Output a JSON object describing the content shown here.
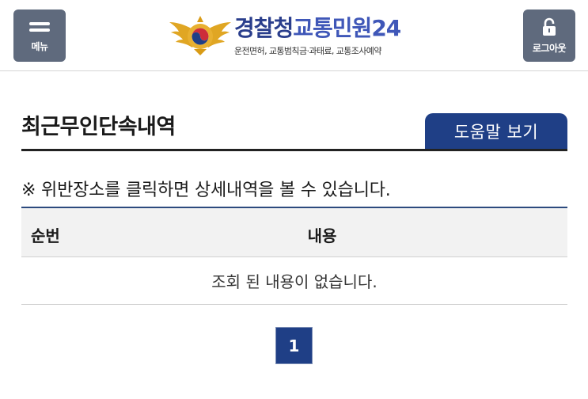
{
  "header": {
    "menu_label": "메뉴",
    "logout_label": "로그아웃",
    "logo_title_main": "경찰청",
    "logo_title_sub": "교통민원24",
    "logo_subtitle": "운전면허, 교통범칙금·과태료, 교통조사예약"
  },
  "main": {
    "page_title": "최근무인단속내역",
    "help_button": "도움말 보기",
    "notice": "※ 위반장소를 클릭하면 상세내역을 볼 수 있습니다.",
    "table": {
      "headers": [
        "순번",
        "내용"
      ],
      "empty_message": "조회 된 내용이 없습니다."
    },
    "pagination": {
      "current_page": "1"
    }
  },
  "colors": {
    "header_button": "#5f6a7d",
    "primary_navy": "#1f3f86",
    "logo_blue": "#2a3e8c"
  }
}
